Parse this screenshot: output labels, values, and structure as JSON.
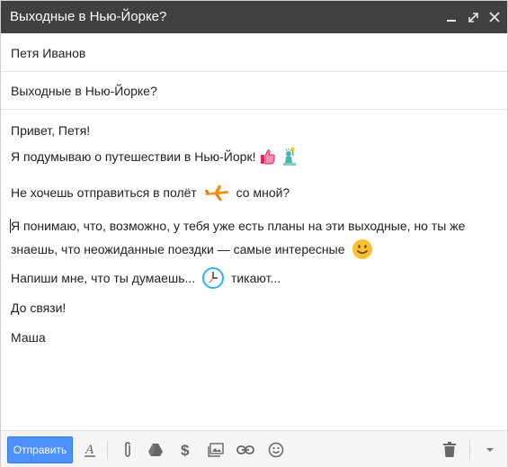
{
  "window": {
    "title": "Выходные в Нью-Йорке?"
  },
  "recipient": {
    "value": "Петя Иванов"
  },
  "subject": {
    "value": "Выходные в Нью-Йорке?"
  },
  "body": {
    "greeting": "Привет, Петя!",
    "line1": "Я подумываю о путешествии в Нью-Йорк!",
    "line2_before": "Не хочешь отправиться в полёт",
    "line2_after": "со мной?",
    "line3a": "Я понимаю, что, возможно, у тебя уже есть планы на эти выходные, но ты же",
    "line3b": "знаешь, что неожиданные поездки — самые интересные",
    "line4_before": "Напиши мне, что ты думаешь...",
    "line4_after": "тикают...",
    "closing": "До связи!",
    "signature": "Маша"
  },
  "toolbar": {
    "send_label": "Отправить"
  },
  "colors": {
    "titlebar": "#404040",
    "send": "#4d90fe",
    "icon": "#666666"
  },
  "icons": [
    "minimize-icon",
    "expand-icon",
    "close-icon",
    "format-text-icon",
    "attach-icon",
    "drive-icon",
    "money-icon",
    "photo-icon",
    "link-icon",
    "emoji-icon",
    "trash-icon",
    "more-options-icon",
    "thumbs-up-icon",
    "statue-of-liberty-icon",
    "airplane-icon",
    "smile-icon",
    "clock-icon"
  ]
}
